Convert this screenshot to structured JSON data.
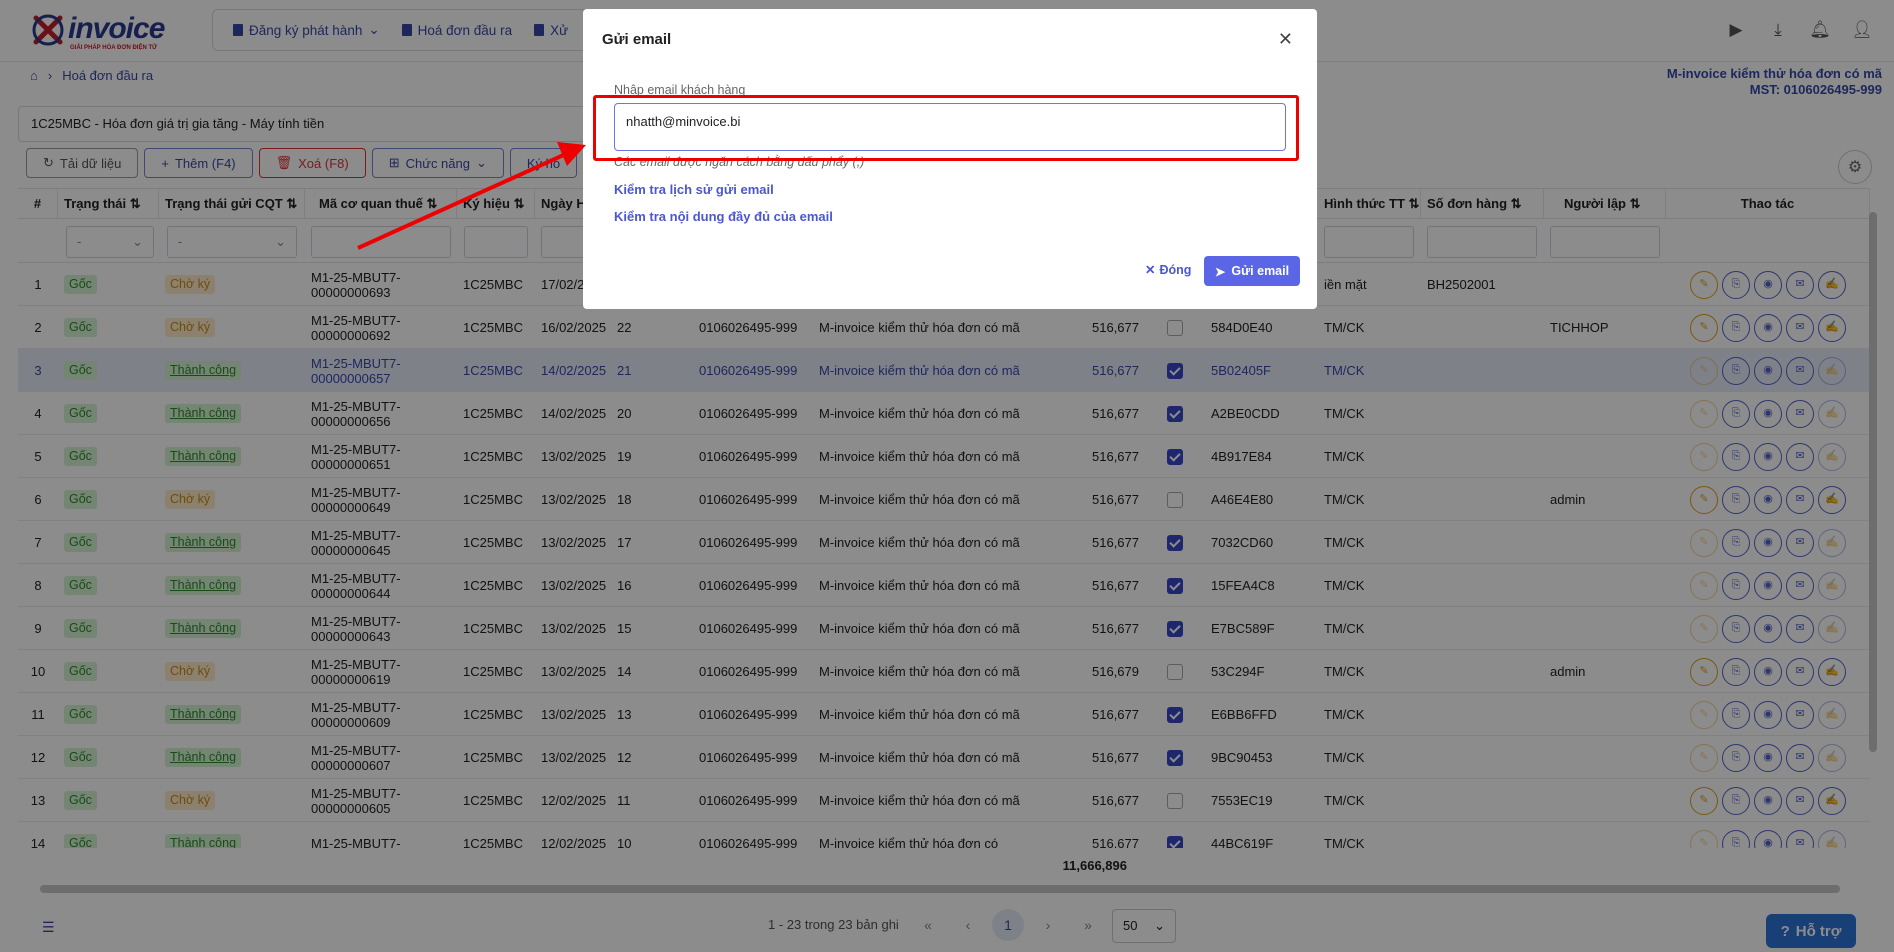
{
  "logo": {
    "text": "invoice",
    "tagline": "GIẢI PHÁP HÓA ĐƠN ĐIỆN TỬ"
  },
  "nav": {
    "items": [
      "Đăng ký phát hành",
      "Hoá đơn đầu ra",
      "Xử"
    ]
  },
  "breadcrumb": {
    "label": "Hoá đơn đầu ra"
  },
  "company": {
    "name": "M-invoice kiểm thử hóa đơn có mã",
    "mst": "MST: 0106026495-999"
  },
  "selector": {
    "value": "1C25MBC - Hóa đơn giá trị gia tăng - Máy tính tiền"
  },
  "toolbar": {
    "reload": "Tải dữ liệu",
    "add": "Thêm (F4)",
    "delete": "Xoá (F8)",
    "functions": "Chức năng",
    "sign": "Ký hó"
  },
  "columns": [
    "#",
    "Trạng thái",
    "Trạng thái gửi CQT",
    "Mã cơ quan thuế",
    "Ký hiệu",
    "Ngày H",
    "",
    "",
    "",
    "",
    "",
    "",
    "Hình thức TT",
    "Số đơn hàng",
    "Người lập",
    "Thao tác"
  ],
  "filters": {
    "status": "-",
    "cqt_status": "-"
  },
  "rows": [
    {
      "no": "1",
      "status": "Gốc",
      "cqt": "Chờ ký",
      "code": "M1-25-MBUT7-00000000693",
      "symbol": "1C25MBC",
      "date": "17/02/2",
      "num": "",
      "mst": "",
      "buyer": "",
      "amount": "",
      "checked": false,
      "code2": "",
      "pay": "iền mặt",
      "order": "BH2502001",
      "creator": ""
    },
    {
      "no": "2",
      "status": "Gốc",
      "cqt": "Chờ ký",
      "code": "M1-25-MBUT7-00000000692",
      "symbol": "1C25MBC",
      "date": "16/02/2025",
      "num": "22",
      "mst": "0106026495-999",
      "buyer": "M-invoice kiểm thử hóa đơn có mã",
      "amount": "516,677",
      "checked": false,
      "code2": "584D0E40",
      "pay": "TM/CK",
      "order": "",
      "creator": "TICHHOP"
    },
    {
      "no": "3",
      "status": "Gốc",
      "cqt": "Thành công",
      "code": "M1-25-MBUT7-00000000657",
      "symbol": "1C25MBC",
      "date": "14/02/2025",
      "num": "21",
      "mst": "0106026495-999",
      "buyer": "M-invoice kiểm thử hóa đơn có mã",
      "amount": "516,677",
      "checked": true,
      "code2": "5B02405F",
      "pay": "TM/CK",
      "order": "",
      "creator": ""
    },
    {
      "no": "4",
      "status": "Gốc",
      "cqt": "Thành công",
      "code": "M1-25-MBUT7-00000000656",
      "symbol": "1C25MBC",
      "date": "14/02/2025",
      "num": "20",
      "mst": "0106026495-999",
      "buyer": "M-invoice kiểm thử hóa đơn có mã",
      "amount": "516,677",
      "checked": true,
      "code2": "A2BE0CDD",
      "pay": "TM/CK",
      "order": "",
      "creator": ""
    },
    {
      "no": "5",
      "status": "Gốc",
      "cqt": "Thành công",
      "code": "M1-25-MBUT7-00000000651",
      "symbol": "1C25MBC",
      "date": "13/02/2025",
      "num": "19",
      "mst": "0106026495-999",
      "buyer": "M-invoice kiểm thử hóa đơn có mã",
      "amount": "516,677",
      "checked": true,
      "code2": "4B917E84",
      "pay": "TM/CK",
      "order": "",
      "creator": ""
    },
    {
      "no": "6",
      "status": "Gốc",
      "cqt": "Chờ ký",
      "code": "M1-25-MBUT7-00000000649",
      "symbol": "1C25MBC",
      "date": "13/02/2025",
      "num": "18",
      "mst": "0106026495-999",
      "buyer": "M-invoice kiểm thử hóa đơn có mã",
      "amount": "516,677",
      "checked": false,
      "code2": "A46E4E80",
      "pay": "TM/CK",
      "order": "",
      "creator": "admin"
    },
    {
      "no": "7",
      "status": "Gốc",
      "cqt": "Thành công",
      "code": "M1-25-MBUT7-00000000645",
      "symbol": "1C25MBC",
      "date": "13/02/2025",
      "num": "17",
      "mst": "0106026495-999",
      "buyer": "M-invoice kiểm thử hóa đơn có mã",
      "amount": "516,677",
      "checked": true,
      "code2": "7032CD60",
      "pay": "TM/CK",
      "order": "",
      "creator": ""
    },
    {
      "no": "8",
      "status": "Gốc",
      "cqt": "Thành công",
      "code": "M1-25-MBUT7-00000000644",
      "symbol": "1C25MBC",
      "date": "13/02/2025",
      "num": "16",
      "mst": "0106026495-999",
      "buyer": "M-invoice kiểm thử hóa đơn có mã",
      "amount": "516,677",
      "checked": true,
      "code2": "15FEA4C8",
      "pay": "TM/CK",
      "order": "",
      "creator": ""
    },
    {
      "no": "9",
      "status": "Gốc",
      "cqt": "Thành công",
      "code": "M1-25-MBUT7-00000000643",
      "symbol": "1C25MBC",
      "date": "13/02/2025",
      "num": "15",
      "mst": "0106026495-999",
      "buyer": "M-invoice kiểm thử hóa đơn có mã",
      "amount": "516,677",
      "checked": true,
      "code2": "E7BC589F",
      "pay": "TM/CK",
      "order": "",
      "creator": ""
    },
    {
      "no": "10",
      "status": "Gốc",
      "cqt": "Chờ ký",
      "code": "M1-25-MBUT7-00000000619",
      "symbol": "1C25MBC",
      "date": "13/02/2025",
      "num": "14",
      "mst": "0106026495-999",
      "buyer": "M-invoice kiểm thử hóa đơn có mã",
      "amount": "516,679",
      "checked": false,
      "code2": "53C294F",
      "pay": "TM/CK",
      "order": "",
      "creator": "admin"
    },
    {
      "no": "11",
      "status": "Gốc",
      "cqt": "Thành công",
      "code": "M1-25-MBUT7-00000000609",
      "symbol": "1C25MBC",
      "date": "13/02/2025",
      "num": "13",
      "mst": "0106026495-999",
      "buyer": "M-invoice kiểm thử hóa đơn có mã",
      "amount": "516,677",
      "checked": true,
      "code2": "E6BB6FFD",
      "pay": "TM/CK",
      "order": "",
      "creator": ""
    },
    {
      "no": "12",
      "status": "Gốc",
      "cqt": "Thành công",
      "code": "M1-25-MBUT7-00000000607",
      "symbol": "1C25MBC",
      "date": "13/02/2025",
      "num": "12",
      "mst": "0106026495-999",
      "buyer": "M-invoice kiểm thử hóa đơn có mã",
      "amount": "516,677",
      "checked": true,
      "code2": "9BC90453",
      "pay": "TM/CK",
      "order": "",
      "creator": ""
    },
    {
      "no": "13",
      "status": "Gốc",
      "cqt": "Chờ ký",
      "code": "M1-25-MBUT7-00000000605",
      "symbol": "1C25MBC",
      "date": "12/02/2025",
      "num": "11",
      "mst": "0106026495-999",
      "buyer": "M-invoice kiểm thử hóa đơn có mã",
      "amount": "516,677",
      "checked": false,
      "code2": "7553EC19",
      "pay": "TM/CK",
      "order": "",
      "creator": ""
    },
    {
      "no": "14",
      "status": "Gốc",
      "cqt": "Thành công",
      "code": "M1-25-MBUT7-",
      "symbol": "1C25MBC",
      "date": "12/02/2025",
      "num": "10",
      "mst": "0106026495-999",
      "buyer": "M-invoice kiểm thử hóa đơn có",
      "amount": "516,677",
      "checked": true,
      "code2": "44BC619F",
      "pay": "TM/CK",
      "order": "",
      "creator": ""
    }
  ],
  "total": "11,666,896",
  "pagination": {
    "info": "1 - 23 trong 23 bản ghi",
    "current": "1",
    "page_size": "50"
  },
  "support": {
    "label": "Hỗ trợ"
  },
  "modal": {
    "title": "Gửi email",
    "label": "Nhập email khách hàng",
    "email_value": "nhatth@minvoice.bi",
    "hint": "Các email được ngăn cách bằng dấu phẩy (,)",
    "link_history": "Kiểm tra lịch sử gửi email",
    "link_content": "Kiểm tra nội dung đầy đủ của email",
    "cancel": "Đóng",
    "send": "Gửi email"
  },
  "colors": {
    "accent": "#3848a8",
    "highlight": "#e00000",
    "send_button": "#5b66e6"
  }
}
